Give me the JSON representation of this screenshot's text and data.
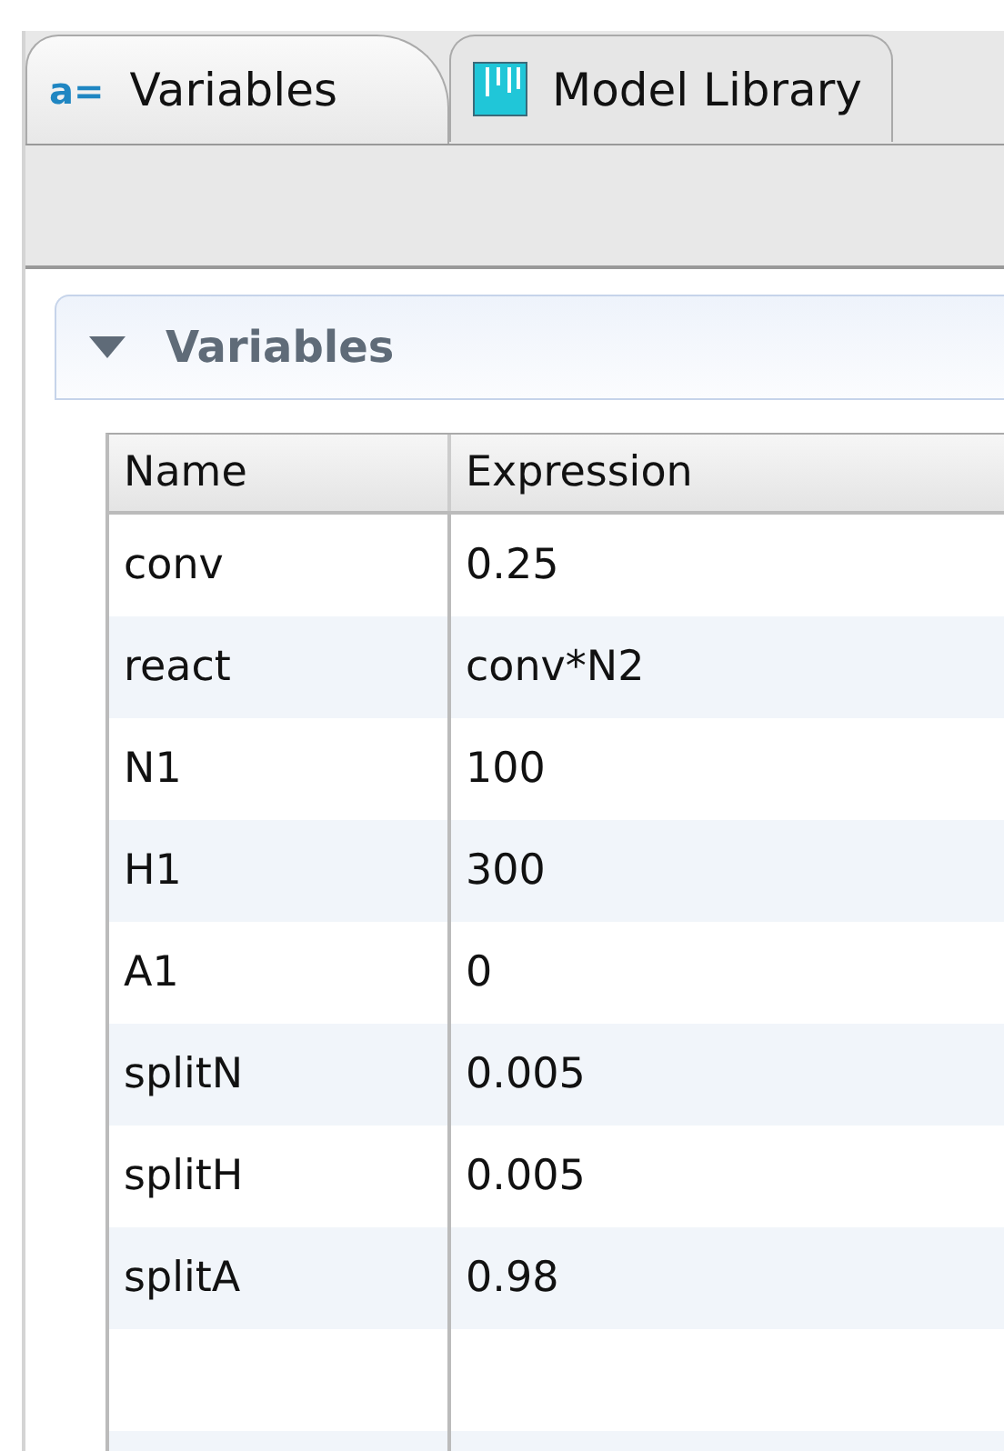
{
  "tabs": [
    {
      "icon_text": "a=",
      "label": "Variables",
      "selected": true
    },
    {
      "label": "Model Library",
      "selected": false
    }
  ],
  "section": {
    "title": "Variables",
    "expanded": true
  },
  "table": {
    "columns": [
      "Name",
      "Expression"
    ],
    "rows": [
      [
        "conv",
        "0.25"
      ],
      [
        "react",
        "conv*N2"
      ],
      [
        "N1",
        "100"
      ],
      [
        "H1",
        "300"
      ],
      [
        "A1",
        "0"
      ],
      [
        "splitN",
        "0.005"
      ],
      [
        "splitH",
        "0.005"
      ],
      [
        "splitA",
        "0.98"
      ]
    ]
  }
}
